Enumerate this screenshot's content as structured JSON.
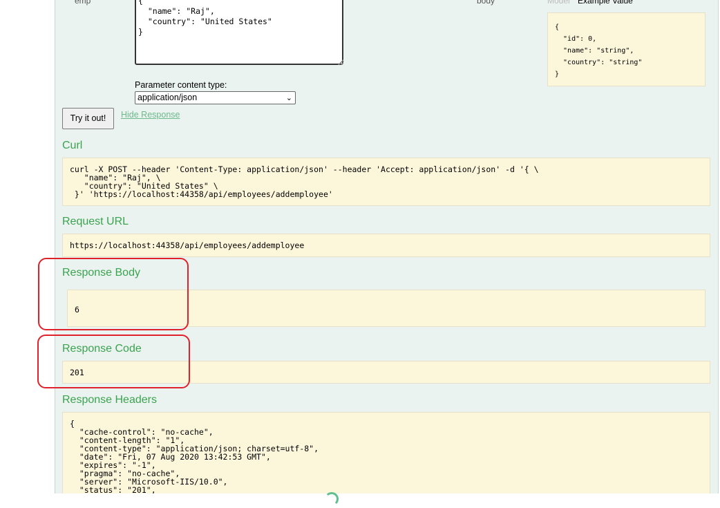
{
  "labels": {
    "param_name": "emp",
    "param_type": "body",
    "model_tab": "Model",
    "example_tab": "Example Value"
  },
  "request_body": "{\n  \"name\": \"Raj\",\n  \"country\": \"United States\"\n}",
  "example_value": "{\n  \"id\": 0,\n  \"name\": \"string\",\n  \"country\": \"string\"\n}",
  "content_type": {
    "label": "Parameter content type:",
    "selected": "application/json"
  },
  "buttons": {
    "try": "Try it out!",
    "hide_response": "Hide Response"
  },
  "curl": {
    "heading": "Curl",
    "command": "curl -X POST --header 'Content-Type: application/json' --header 'Accept: application/json' -d '{ \\\n   \"name\": \"Raj\", \\\n   \"country\": \"United States\" \\\n }' 'https://localhost:44358/api/employees/addemployee'"
  },
  "request_url": {
    "heading": "Request URL",
    "value": "https://localhost:44358/api/employees/addemployee"
  },
  "response_body": {
    "heading": "Response Body",
    "value": "6"
  },
  "response_code": {
    "heading": "Response Code",
    "value": "201"
  },
  "response_headers": {
    "heading": "Response Headers",
    "value": "{\n  \"cache-control\": \"no-cache\",\n  \"content-length\": \"1\",\n  \"content-type\": \"application/json; charset=utf-8\",\n  \"date\": \"Fri, 07 Aug 2020 13:42:53 GMT\",\n  \"expires\": \"-1\",\n  \"pragma\": \"no-cache\",\n  \"server\": \"Microsoft-IIS/10.0\",\n  \"status\": \"201\","
  },
  "colors": {
    "accent_green": "#3aa34f",
    "code_background": "#fcf6db",
    "panel_background": "#ebf3f0",
    "highlight_red": "#e0202a"
  }
}
